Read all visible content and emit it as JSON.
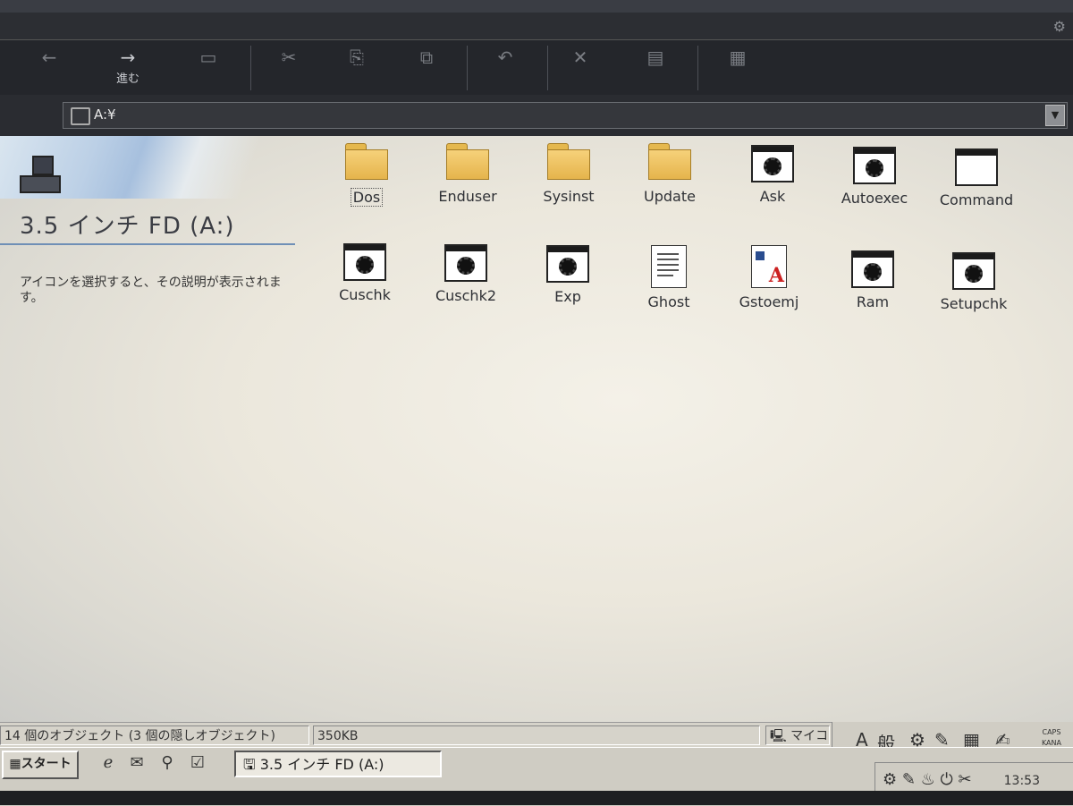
{
  "toolbar": {
    "buttons": [
      {
        "glyph": "←",
        "label": "",
        "icon": "back-arrow-icon"
      },
      {
        "glyph": "→",
        "label": "進む",
        "icon": "forward-arrow-icon"
      },
      {
        "glyph": "▭",
        "label": "",
        "icon": "up-folder-icon"
      },
      {
        "glyph": "✂",
        "label": "",
        "icon": "cut-icon"
      },
      {
        "glyph": "⎘",
        "label": "",
        "icon": "copy-icon"
      },
      {
        "glyph": "⧉",
        "label": "",
        "icon": "paste-icon"
      },
      {
        "glyph": "↶",
        "label": "",
        "icon": "undo-icon"
      },
      {
        "glyph": "✕",
        "label": "",
        "icon": "delete-icon"
      },
      {
        "glyph": "▤",
        "label": "",
        "icon": "properties-icon"
      },
      {
        "glyph": "▦",
        "label": "",
        "icon": "views-icon"
      }
    ]
  },
  "address": {
    "value": "A:¥"
  },
  "sidebar": {
    "title": "3.5 インチ FD (A:)",
    "hint": "アイコンを選択すると、その説明が表示されます。"
  },
  "items": [
    {
      "label": "Dos",
      "type": "folder",
      "selected": true
    },
    {
      "label": "Enduser",
      "type": "folder"
    },
    {
      "label": "Sysinst",
      "type": "folder"
    },
    {
      "label": "Update",
      "type": "folder"
    },
    {
      "label": "Ask",
      "type": "app"
    },
    {
      "label": "Autoexec",
      "type": "app"
    },
    {
      "label": "Command",
      "type": "window"
    },
    {
      "label": "Cuschk",
      "type": "app"
    },
    {
      "label": "Cuschk2",
      "type": "app"
    },
    {
      "label": "Exp",
      "type": "app"
    },
    {
      "label": "Ghost",
      "type": "text"
    },
    {
      "label": "Gstoemj",
      "type": "doc"
    },
    {
      "label": "Ram",
      "type": "app"
    },
    {
      "label": "Setupchk",
      "type": "app"
    }
  ],
  "status": {
    "objects": "14 個のオブジェクト (3 個の隠しオブジェクト)",
    "size": "350KB",
    "zone": "マイコ"
  },
  "ime": {
    "mode": "A",
    "conv": "般",
    "caps": "CAPS",
    "kana": "KANA"
  },
  "taskbar": {
    "start_label": "スタート",
    "task_label": "3.5 インチ FD (A:)",
    "clock": "13:53"
  }
}
